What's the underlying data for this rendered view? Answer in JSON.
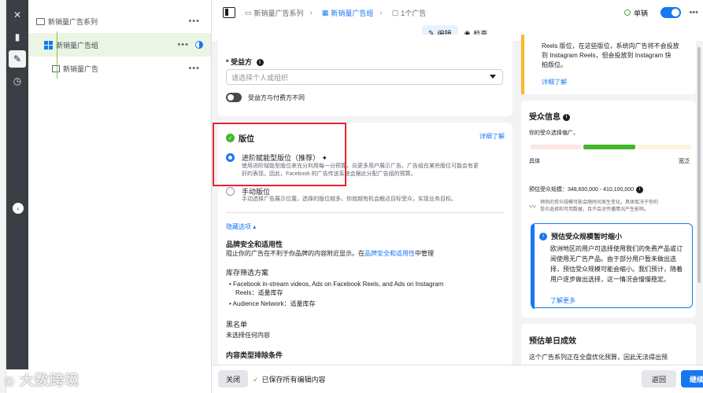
{
  "tree": {
    "items": [
      {
        "label": "新销量广告系列",
        "more": "•••"
      },
      {
        "label": "新销量广告组",
        "more": "•••"
      },
      {
        "label": "新销量广告",
        "more": "•••"
      }
    ]
  },
  "topbar": {
    "crumbs": [
      "新销量广告系列",
      "新销量广告组",
      "1个广告"
    ],
    "single_label": "单辆",
    "more": "•••"
  },
  "modebar": {
    "edit": "编辑",
    "view": "检查"
  },
  "beneficiary": {
    "label": "* 受益方",
    "placeholder": "请选择个人或组织",
    "toggle_label": "受益方与付费方不同"
  },
  "placement": {
    "title": "版位",
    "learn_more": "详细了解",
    "advantage_title": "进阶赋能型版位（推荐）",
    "advantage_desc_1": "使用进阶赋能型版位来充分利用每一分预算，向更多用户展示广告。广告组在某些版位可能会有更",
    "advantage_desc_2": "好的表现，因此，Facebook 的广告传送系统会据此分配广告组的预算。",
    "manual_title": "手动版位",
    "manual_desc": "手动选择广告展示位置。选择的版位越多，你就越有机会触达目标受众，实现业务目标。",
    "hide_options": "隐藏选项 ▴",
    "brand_safety_title": "品牌安全和适用性",
    "brand_safety_desc_prefix": "阻止你的广告在不利于你品牌的内容附近显示。在",
    "brand_safety_link": "品牌安全和适用性",
    "brand_safety_desc_suffix": "中管理",
    "inventory_title": "库存筛选方案",
    "inventory_1": "Facebook in-stream videos, Ads on Facebook Reels, and Ads on Instagram",
    "inventory_1b": "Reels：适量库存",
    "inventory_2": "Audience Network：适量库存",
    "blocklist_title": "黑名单",
    "blocklist_value": "未选择任何内容",
    "content_type_title": "内容类型排除条件"
  },
  "right": {
    "top_text_1": "Reels 版位，在这些版位，系统向广告将不会投放",
    "top_text_2": "到 Instagram Reels，但会投放到 Instagram 快",
    "top_text_3": "拍版位。",
    "top_link": "详细了解",
    "audience_title": "受众信息",
    "audience_desc": "你的受众选择偏广。",
    "specific": "具体",
    "broad": "宽泛",
    "est_size": "预估受众规模：348,600,000 - 410,100,000",
    "est_note_1": "预估的受众规模可能会随时间发生变化。具体取决于你的",
    "est_note_2": "受众选择和可用数据，且不会对传播情况产生影响。",
    "tip_title": "预估受众规模暂时缩小",
    "tip_body": "欧洲地区的用户可选择使用我们的免费产品或订阅使用无广告产品。由于部分用户暂未做出选择，预估受众规模可能会缩小。我们预计，随着用户逐步做出选择，这一情况会慢慢稳定。",
    "tip_link": "了解更多",
    "daily_title": "预估单日成效",
    "daily_desc": "这个广告系列正在全盘优化预算，因此无法得出预"
  },
  "bottombar": {
    "close": "关闭",
    "saved": "已保存所有编辑内容",
    "back": "返回",
    "next": "继续"
  },
  "watermark": "大数跨境"
}
